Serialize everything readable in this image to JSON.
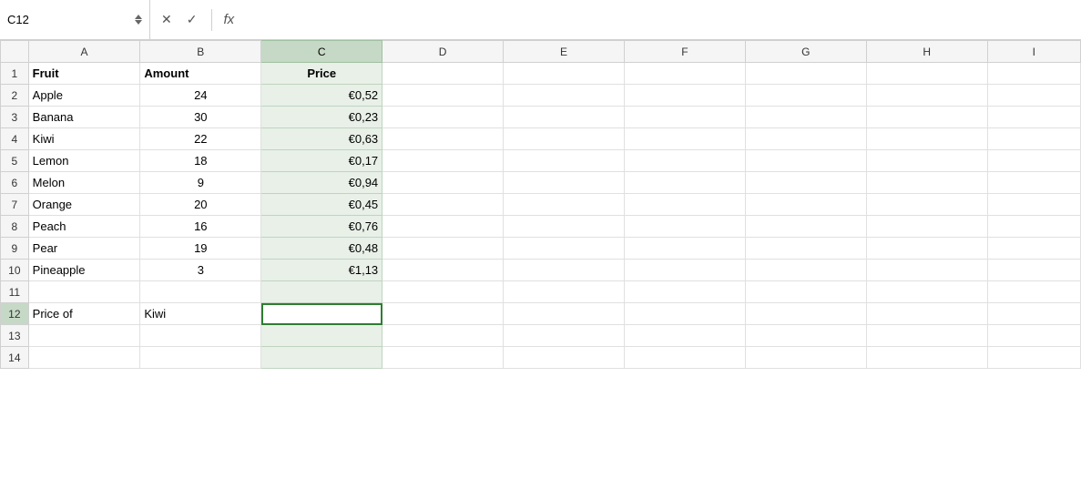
{
  "formula_bar": {
    "cell_ref": "C12",
    "fx_label": "fx",
    "x_label": "✕",
    "check_label": "✓",
    "formula_value": ""
  },
  "columns": [
    "",
    "A",
    "B",
    "C",
    "D",
    "E",
    "F",
    "G",
    "H",
    "I"
  ],
  "rows": [
    {
      "row_num": "1",
      "a": "Fruit",
      "b": "Amount",
      "c": "Price",
      "a_bold": true,
      "b_bold": true,
      "c_bold": true
    },
    {
      "row_num": "2",
      "a": "Apple",
      "b": "24",
      "c": "€0,52"
    },
    {
      "row_num": "3",
      "a": "Banana",
      "b": "30",
      "c": "€0,23"
    },
    {
      "row_num": "4",
      "a": "Kiwi",
      "b": "22",
      "c": "€0,63"
    },
    {
      "row_num": "5",
      "a": "Lemon",
      "b": "18",
      "c": "€0,17"
    },
    {
      "row_num": "6",
      "a": "Melon",
      "b": "9",
      "c": "€0,94"
    },
    {
      "row_num": "7",
      "a": "Orange",
      "b": "20",
      "c": "€0,45"
    },
    {
      "row_num": "8",
      "a": "Peach",
      "b": "16",
      "c": "€0,76"
    },
    {
      "row_num": "9",
      "a": "Pear",
      "b": "19",
      "c": "€0,48"
    },
    {
      "row_num": "10",
      "a": "Pineapple",
      "b": "3",
      "c": "€1,13"
    },
    {
      "row_num": "11",
      "a": "",
      "b": "",
      "c": ""
    },
    {
      "row_num": "12",
      "a": "Price of",
      "b": "Kiwi",
      "c": ""
    },
    {
      "row_num": "13",
      "a": "",
      "b": "",
      "c": ""
    },
    {
      "row_num": "14",
      "a": "",
      "b": "",
      "c": ""
    }
  ],
  "active_cell": "C12",
  "active_row": 12,
  "active_col": "C"
}
